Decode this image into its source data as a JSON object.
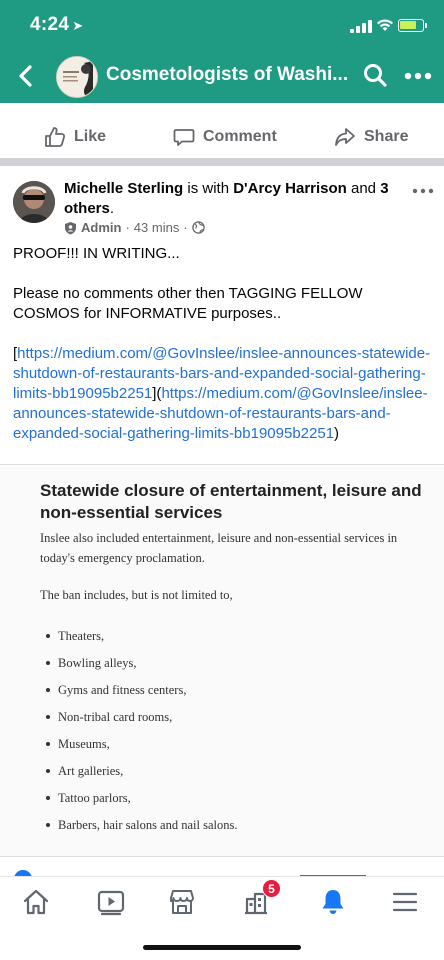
{
  "status_bar": {
    "time": "4:24"
  },
  "header": {
    "title": "Cosmetologists of Washi...",
    "colors": {
      "background": "#1f9a83",
      "text": "#ffffff"
    }
  },
  "action_bar": {
    "like_label": "Like",
    "comment_label": "Comment",
    "share_label": "Share"
  },
  "post": {
    "author": "Michelle Sterling",
    "with_text": " is with ",
    "tagged": "D'Arcy Harrison",
    "and_text": " and ",
    "others": "3 others",
    "period": ".",
    "role": "Admin",
    "time": "43 mins",
    "separator": "·",
    "body_line1": "PROOF!!!  IN WRITING...",
    "body_line2": "Please no comments other then TAGGING FELLOW COSMOS for INFORMATIVE purposes..",
    "link_open": "[",
    "link_text": "https://medium.com/@GovInslee/inslee-announces-statewide-shutdown-of-restaurants-bars-and-expanded-social-gathering-limits-bb19095b2251",
    "link_mid": "](",
    "link_text2": "https://medium.com/@GovInslee/inslee-announces-statewide-shutdown-of-restaurants-bars-and-expanded-social-gathering-limits-bb19095b2251",
    "link_close": ")"
  },
  "article": {
    "heading": "Statewide closure of entertainment, leisure and non-essential services",
    "intro": "Inslee also included entertainment, leisure and non-essential services in today's emergency proclamation.",
    "lead": "The ban includes, but is not limited to,",
    "items": [
      "Theaters,",
      "Bowling alleys,",
      "Gyms and fitness centers,",
      "Non-tribal card rooms,",
      "Museums,",
      "Art galleries,",
      "Tattoo parlors,",
      "Barbers, hair salons and nail salons."
    ]
  },
  "tabbar": {
    "notification_badge": "5",
    "accent_color": "#1877f2"
  }
}
